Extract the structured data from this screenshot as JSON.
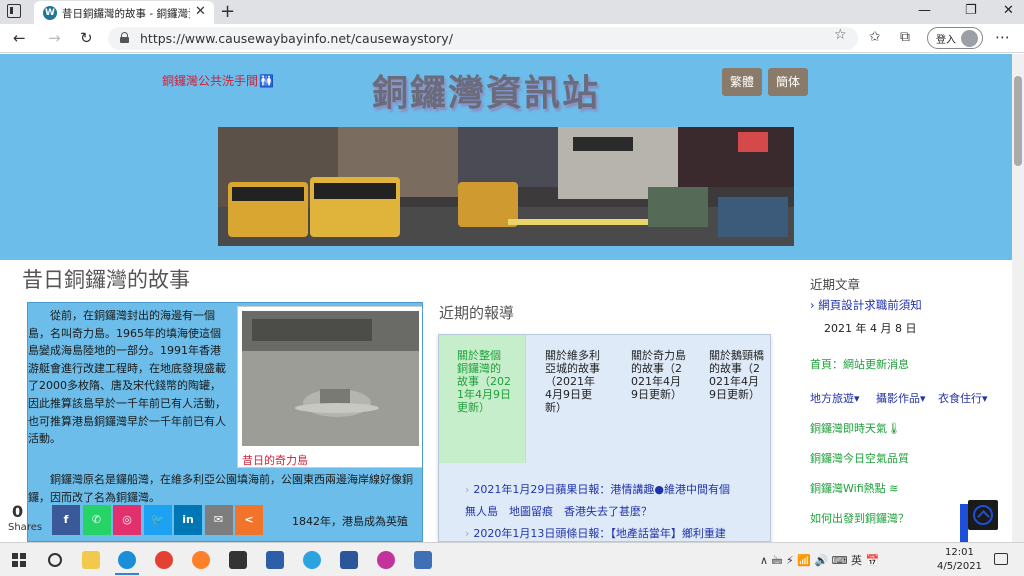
{
  "browser": {
    "tab_title": "昔日銅鑼灣的故事 - 銅鑼灣資訊站",
    "tab_favicon": "W",
    "url": "https://www.causewaybayinfo.net/causewaystory/",
    "signin_label": "登入",
    "icons": [
      "tab-actions-icon",
      "close-icon",
      "new-tab-icon",
      "minimize-icon",
      "maximize-icon",
      "back-icon",
      "forward-icon",
      "refresh-icon",
      "lock-icon",
      "favorite-star-icon",
      "favorites-icon",
      "collections-icon",
      "more-icon"
    ]
  },
  "header": {
    "restroom_link": "銅鑼灣公共洗手間",
    "restroom_icon": "🚻",
    "site_title": "銅鑼灣資訊站",
    "lang_traditional": "繁體",
    "lang_simplified": "簡体"
  },
  "main": {
    "page_title": "昔日銅鑼灣的故事",
    "story_para1": "　　從前，在銅鑼灣封出的海邊有一個島，名叫奇力島。1965年的填海使這個島變成海島陸地的一部分。1991年香港游艇會進行改建工程時，在地底發現盛載了2000多枚隋、唐及宋代錢幣的陶罐，因此推算該島早於一千年前已有人活動，也可推算港島銅鑼灣早於一千年前已有人活動。",
    "story_para2": "　　銅鑼灣原名是鑼船灣，在維多利亞公園填海前，公園東西兩邊海岸線好像銅鑼，因而改了名為銅鑼灣。",
    "story_para3": "1842年，港島成為英殖",
    "photo_caption": "昔日的奇力島"
  },
  "reports": {
    "heading": "近期的報導",
    "columns": [
      "關於整個銅鑼灣的故事（2021年4月9日更新）",
      "關於維多利亞城的故事（2021年4月9日更新）",
      "關於奇力島的故事（2021年4月9日更新）",
      "關於鵝頸橋的故事（2021年4月9日更新）"
    ],
    "news": [
      "2021年1月29日蘋果日報：港情講趣●維港中間有個",
      "無人島　地圖留痕　香港失去了甚麼？",
      "2020年1月13日頭條日報：【地產話當年】鄉利重建"
    ]
  },
  "sidebar": {
    "heading": "近期文章",
    "recent_post": "網頁設計求職前須知",
    "recent_date": "2021 年 4 月 8 日",
    "links": {
      "homepage": "首頁：網站更新消息",
      "menu_travel": "地方旅遊▾",
      "menu_photo": "攝影作品▾",
      "menu_food": "衣食住行▾",
      "weather": "銅鑼灣即時天氣🌡",
      "air_quality": "銅鑼灣今日空氣品質",
      "wifi": "銅鑼灣Wifi熱點",
      "directions": "如何出發到銅鑼灣？"
    }
  },
  "share": {
    "count": "0",
    "label": "Shares",
    "buttons": [
      {
        "name": "facebook",
        "glyph": "f",
        "color": "#3b5998"
      },
      {
        "name": "whatsapp",
        "glyph": "✆",
        "color": "#25d366"
      },
      {
        "name": "instagram",
        "glyph": "◎",
        "color": "#e1306c"
      },
      {
        "name": "twitter",
        "glyph": "🐦",
        "color": "#1da1f2"
      },
      {
        "name": "linkedin",
        "glyph": "in",
        "color": "#0077b5"
      },
      {
        "name": "email",
        "glyph": "✉",
        "color": "#7d7d7d"
      },
      {
        "name": "more",
        "glyph": "<",
        "color": "#f0742a"
      }
    ]
  },
  "taskbar": {
    "tray_text": "∧ 🖮 ⚡ 📶 🔊 ⌨ 英 📅",
    "clock_time": "12:01",
    "clock_date": "4/5/2021"
  },
  "colors": {
    "header_bg": "#6cbde9",
    "accent_red": "#d0203a",
    "link_green": "#1ea03a",
    "link_blue": "#2233aa"
  }
}
